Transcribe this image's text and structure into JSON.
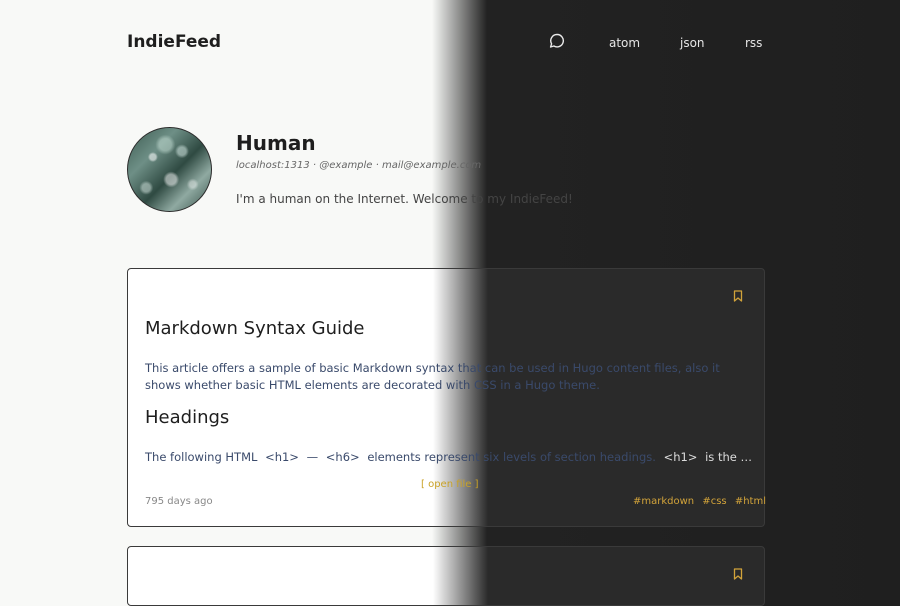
{
  "header": {
    "site_title": "IndieFeed",
    "nav": {
      "comment_icon": "speech-bubble-icon",
      "atom": "atom",
      "json": "json",
      "rss": "rss"
    }
  },
  "profile": {
    "name": "Human",
    "meta": "localhost:1313 · @example · mail@example.com",
    "bio": "I'm a human on the Internet. Welcome to my IndieFeed!"
  },
  "post": {
    "title": "Markdown Syntax Guide",
    "excerpt": "This article offers a sample of basic Markdown syntax that can be used in Hugo content files, also it shows whether basic HTML elements are decorated with CSS in a Hugo theme.",
    "heading": "Headings",
    "text_before": "The following HTML",
    "code1": "<h1>",
    "dash": "—",
    "code2": "<h6>",
    "text_mid": "elements represent six levels of section headings.",
    "code3": "<h1>",
    "text_after": "is the …",
    "open_link": "[ open file ]",
    "date": "795 days ago",
    "tags": [
      "#markdown",
      "#css",
      "#html"
    ],
    "bookmark_icon": "bookmark-icon"
  },
  "colors": {
    "accent": "#d2a33a",
    "light_bg": "#f8f9f7",
    "dark_bg": "#1f1f1f"
  }
}
